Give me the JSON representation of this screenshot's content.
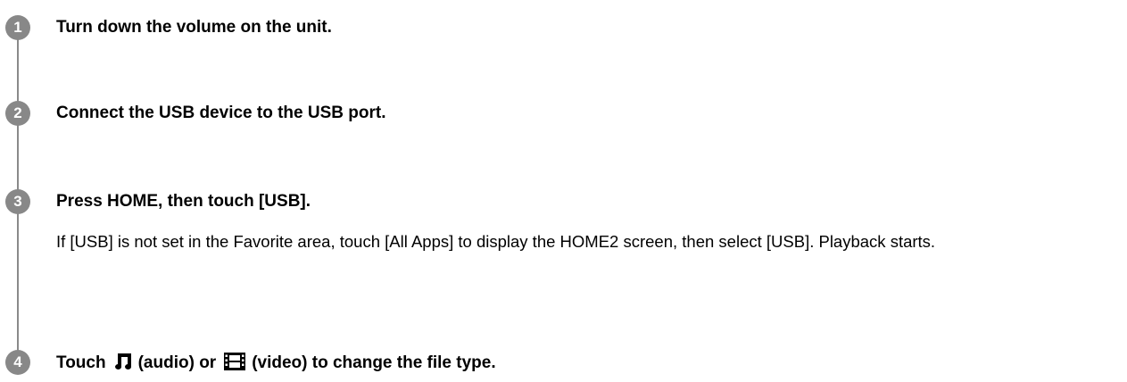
{
  "steps": [
    {
      "number": "1",
      "title": "Turn down the volume on the unit."
    },
    {
      "number": "2",
      "title": "Connect the USB device to the USB port."
    },
    {
      "number": "3",
      "title": "Press HOME, then touch [USB].",
      "description": "If [USB] is not set in the Favorite area, touch [All Apps] to display the HOME2 screen, then select [USB]. Playback starts."
    },
    {
      "number": "4",
      "title_prefix": "Touch",
      "audio_icon": "music-note-icon",
      "audio_text": "(audio) or",
      "video_icon": "film-strip-icon",
      "video_text": "(video) to change the file type."
    }
  ],
  "colors": {
    "badge": "#888888",
    "line": "#8a8a8a",
    "text": "#000000"
  }
}
